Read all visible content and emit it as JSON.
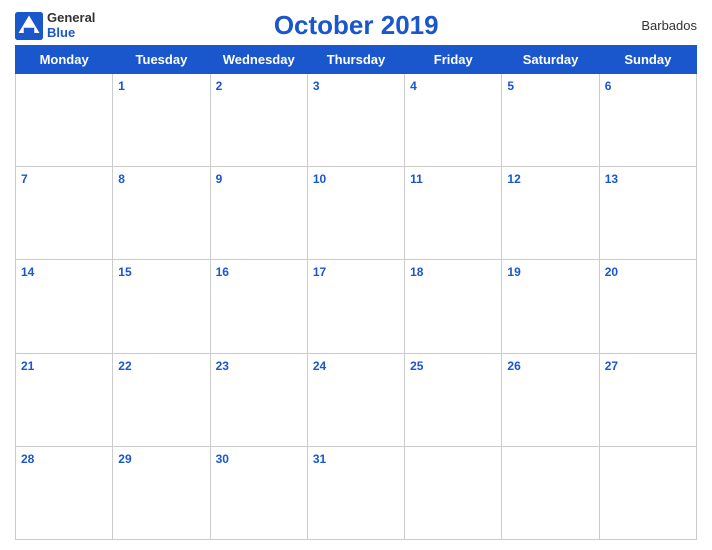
{
  "header": {
    "logo_general": "General",
    "logo_blue": "Blue",
    "month_title": "October 2019",
    "country": "Barbados"
  },
  "days_of_week": [
    "Monday",
    "Tuesday",
    "Wednesday",
    "Thursday",
    "Friday",
    "Saturday",
    "Sunday"
  ],
  "weeks": [
    [
      {
        "day": "",
        "empty": true
      },
      {
        "day": "1"
      },
      {
        "day": "2"
      },
      {
        "day": "3"
      },
      {
        "day": "4"
      },
      {
        "day": "5"
      },
      {
        "day": "6"
      }
    ],
    [
      {
        "day": "7"
      },
      {
        "day": "8"
      },
      {
        "day": "9"
      },
      {
        "day": "10"
      },
      {
        "day": "11"
      },
      {
        "day": "12"
      },
      {
        "day": "13"
      }
    ],
    [
      {
        "day": "14"
      },
      {
        "day": "15"
      },
      {
        "day": "16"
      },
      {
        "day": "17"
      },
      {
        "day": "18"
      },
      {
        "day": "19"
      },
      {
        "day": "20"
      }
    ],
    [
      {
        "day": "21"
      },
      {
        "day": "22"
      },
      {
        "day": "23"
      },
      {
        "day": "24"
      },
      {
        "day": "25"
      },
      {
        "day": "26"
      },
      {
        "day": "27"
      }
    ],
    [
      {
        "day": "28"
      },
      {
        "day": "29"
      },
      {
        "day": "30"
      },
      {
        "day": "31"
      },
      {
        "day": ""
      },
      {
        "day": ""
      },
      {
        "day": ""
      }
    ]
  ]
}
